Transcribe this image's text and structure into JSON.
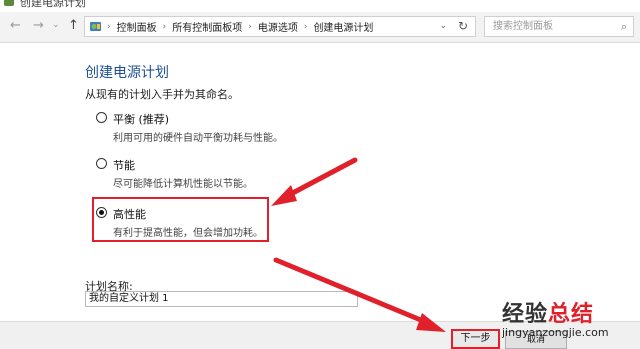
{
  "window": {
    "title": "创建电源计划"
  },
  "nav": {
    "back_glyph": "←",
    "forward_glyph": "→",
    "history_glyph": "⌄",
    "up_glyph": "↑",
    "breadcrumbs": [
      "控制面板",
      "所有控制面板项",
      "电源选项",
      "创建电源计划"
    ],
    "separator_glyph": "›",
    "dropdown_glyph": "⌄",
    "refresh_glyph": "↻",
    "search_placeholder": "搜索控制面板",
    "search_glyph": "⌕"
  },
  "content": {
    "heading": "创建电源计划",
    "instruction": "从现有的计划入手并为其命名。",
    "options": [
      {
        "title": "平衡 (推荐)",
        "description": "利用可用的硬件自动平衡功耗与性能。",
        "checked": false
      },
      {
        "title": "节能",
        "description": "尽可能降低计算机性能以节能。",
        "checked": false
      },
      {
        "title": "高性能",
        "description": "有利于提高性能，但会增加功耗。",
        "checked": true
      }
    ],
    "plan_name_label": "计划名称:",
    "plan_name_value": "我的自定义计划 1"
  },
  "footer": {
    "next_label": "下一步",
    "cancel_label": "取消"
  },
  "watermark": {
    "title_part1": "经验",
    "title_part2": "总结",
    "url": "jingyanzongjie.com"
  },
  "colors": {
    "heading": "#1e4f97",
    "annotation_red": "#e0202a"
  }
}
